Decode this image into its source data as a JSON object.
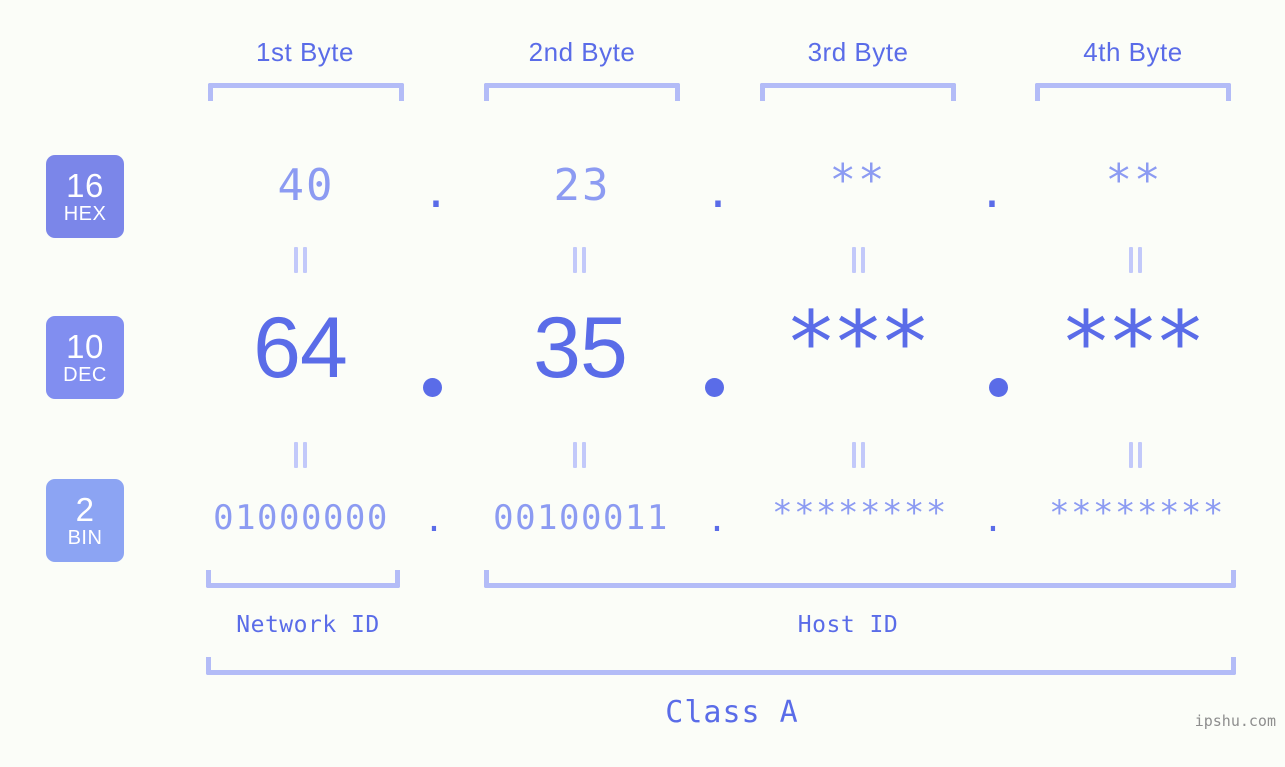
{
  "page": {
    "background_color": "#fbfdf8",
    "accent_color": "#5a6ce8",
    "accent_light_color": "#8c9bf2",
    "bracket_color": "#b3bcf7"
  },
  "byte_headers": [
    {
      "label": "1st Byte"
    },
    {
      "label": "2nd Byte"
    },
    {
      "label": "3rd Byte"
    },
    {
      "label": "4th Byte"
    }
  ],
  "bases": [
    {
      "number": "16",
      "name": "HEX",
      "color": "#7b86e9"
    },
    {
      "number": "10",
      "name": "DEC",
      "color": "#818ef0"
    },
    {
      "number": "2",
      "name": "BIN",
      "color": "#8ca4f3"
    }
  ],
  "rows": {
    "hex": {
      "base_number": "16",
      "base_name": "HEX",
      "values": [
        "40",
        "23",
        "**",
        "**"
      ],
      "separator": "."
    },
    "dec": {
      "base_number": "10",
      "base_name": "DEC",
      "values": [
        "64",
        "35",
        "***",
        "***"
      ],
      "separator": "."
    },
    "bin": {
      "base_number": "2",
      "base_name": "BIN",
      "values": [
        "01000000",
        "00100011",
        "********",
        "********"
      ],
      "separator": "."
    }
  },
  "equality_marks": {
    "symbol": "=",
    "count_per_gap": 4,
    "gaps": 2
  },
  "sections": [
    {
      "label": "Network ID"
    },
    {
      "label": "Host ID"
    }
  ],
  "class": {
    "label": "Class A"
  },
  "watermark": {
    "text": "ipshu.com"
  }
}
